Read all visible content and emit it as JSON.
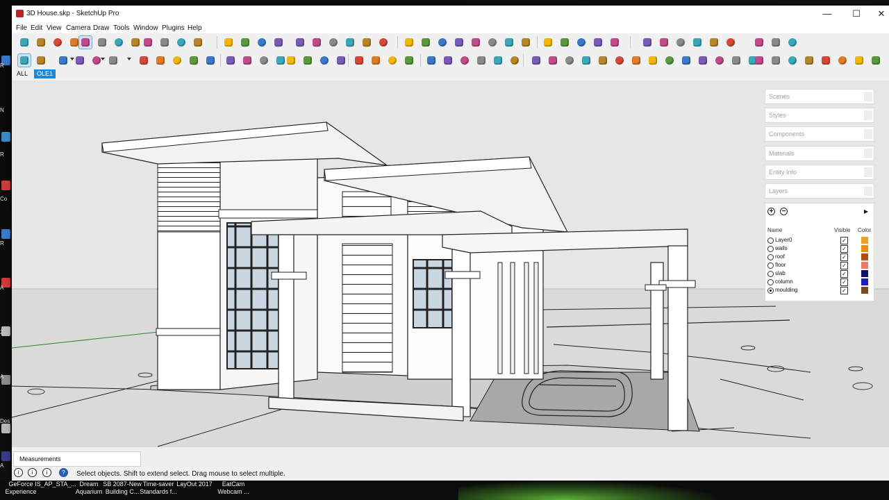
{
  "window": {
    "title": "3D House.skp - SketchUp Pro",
    "controls": {
      "minimize": "—",
      "maximize": "☐",
      "close": "✕"
    }
  },
  "menu": [
    "File",
    "Edit",
    "View",
    "Camera",
    "Draw",
    "Tools",
    "Window",
    "Plugins",
    "Help"
  ],
  "tag_bar": {
    "tags": [
      "ALL",
      "OLE1"
    ],
    "selected": "OLE1"
  },
  "panel": {
    "trays": [
      "Scenes",
      "Styles",
      "Components",
      "Materials",
      "Entity Info",
      "Layers"
    ],
    "layers": {
      "columns": {
        "name": "Name",
        "visible": "Visible",
        "color": "Color"
      },
      "active": "moulding",
      "items": [
        {
          "name": "Layer0",
          "visible": true,
          "color": "#f0a020"
        },
        {
          "name": "walls",
          "visible": true,
          "color": "#f08a10"
        },
        {
          "name": "roof",
          "visible": true,
          "color": "#b84a10"
        },
        {
          "name": "floor",
          "visible": true,
          "color": "#f07868"
        },
        {
          "name": "slab",
          "visible": true,
          "color": "#10106a"
        },
        {
          "name": "column",
          "visible": true,
          "color": "#1a22b8"
        },
        {
          "name": "moulding",
          "visible": true,
          "color": "#7a4a1a"
        }
      ],
      "check_glyph": "✓",
      "add_glyph": "+",
      "remove_glyph": "−",
      "details_glyph": "▸"
    }
  },
  "measurements": {
    "label": "Measurements"
  },
  "status": {
    "text": "Select objects. Shift to extend select. Drag mouse to select multiple.",
    "icons": [
      "i",
      "i",
      "i",
      "?"
    ]
  },
  "taskbar": [
    {
      "line1": "GeForce",
      "line2": "Experience"
    },
    {
      "line1": "IS_AP_STA_...",
      "line2": ""
    },
    {
      "line1": "Dream",
      "line2": "Aquarium"
    },
    {
      "line1": "SB 2087-New",
      "line2": "Building C..."
    },
    {
      "line1": "Time-saver",
      "line2": "Standards f..."
    },
    {
      "line1": "LayOut 2017",
      "line2": ""
    },
    {
      "line1": "EatCam",
      "line2": "Webcam ..."
    }
  ],
  "desktop_labels": [
    "R",
    "N",
    "R",
    "Co",
    "R",
    "A",
    "2",
    "A",
    "Des",
    "A"
  ],
  "colors": {
    "selected_tag": "#1e88d8",
    "viewport_sky": "#e3e3e3",
    "ground": "#dadada"
  }
}
